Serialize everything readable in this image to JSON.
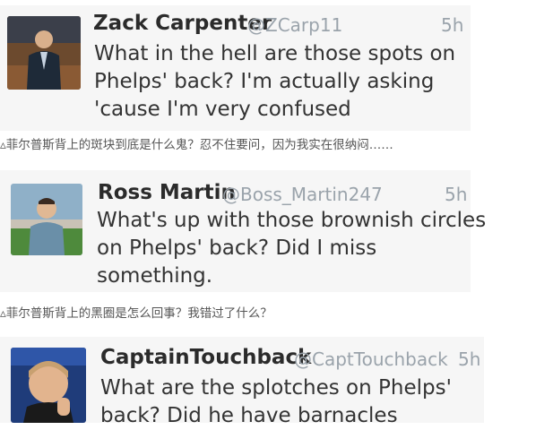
{
  "tweets": [
    {
      "name": "Zack Carpenter",
      "handle": "@ZCarp11",
      "time": "5h",
      "text_lines": [
        "What in the hell are those spots on",
        "Phelps' back? I'm actually asking",
        "'cause I'm very confused"
      ],
      "translation": "▵菲尔普斯背上的斑块到底是什么鬼？忍不住要问，因为我实在很纳闷……"
    },
    {
      "name": "Ross Martin",
      "handle": "@Boss_Martin247",
      "time": "5h",
      "text_lines": [
        "What's up with those brownish circles",
        "on Phelps' back? Did I miss",
        "something."
      ],
      "translation": "▵菲尔普斯背上的黑圈是怎么回事？我错过了什么？"
    },
    {
      "name": "CaptainTouchback",
      "handle": "@CaptTouchback",
      "time": "5h",
      "text_lines": [
        "What are the splotches on Phelps'",
        "back? Did he have barnacles"
      ],
      "translation": ""
    }
  ],
  "colors": {
    "name": "#2b2b2b",
    "meta": "#9aa3ab",
    "body": "#333333",
    "translation": "#555555"
  }
}
